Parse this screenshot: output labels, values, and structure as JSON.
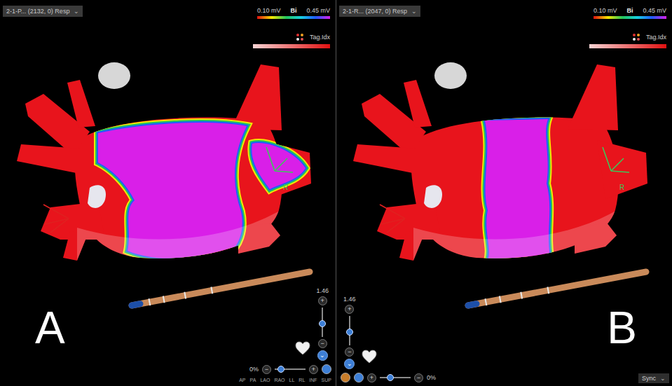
{
  "panels": [
    {
      "letter": "A",
      "kind": "patchy",
      "map_selector": {
        "label": "2-1-P... (2132, 0) Resp",
        "icon": "⌄"
      },
      "scale": {
        "min": "0.10 mV",
        "mode": "Bi",
        "max": "0.45 mV"
      },
      "tag_legend": {
        "label": "Tag.Idx"
      },
      "tag_labels": [
        "R"
      ],
      "zoom": {
        "value": "1.46",
        "level": 0.45,
        "plus": "+",
        "minus": "−",
        "menu_icon": "⌄"
      },
      "opacity": {
        "value": "0%",
        "level": 0.2,
        "minus": "−",
        "plus": "+"
      },
      "round_buttons": [
        {
          "color": "#3d7fd6"
        }
      ],
      "view_buttons": [
        "AP",
        "PA",
        "LAO",
        "RAO",
        "LL",
        "RL",
        "INF",
        "SUP"
      ],
      "sync": null
    },
    {
      "letter": "B",
      "kind": "complete",
      "map_selector": {
        "label": "2-1-R... (2047, 0) Resp",
        "icon": "⌄"
      },
      "scale": {
        "min": "0.10 mV",
        "mode": "Bi",
        "max": "0.45 mV"
      },
      "tag_legend": {
        "label": "Tag.Idx"
      },
      "tag_labels": [
        "R"
      ],
      "zoom": {
        "value": "1.46",
        "level": 0.45,
        "plus": "+",
        "minus": "−",
        "menu_icon": "⌄"
      },
      "opacity": {
        "value": "0%",
        "level": 0.35,
        "minus": "−",
        "plus": "+"
      },
      "round_buttons": [
        {
          "color": "#3d7fd6"
        },
        {
          "color": "#c87d2a"
        }
      ],
      "view_buttons": [],
      "sync": {
        "label": "Sync",
        "icon": "⌄"
      }
    }
  ]
}
